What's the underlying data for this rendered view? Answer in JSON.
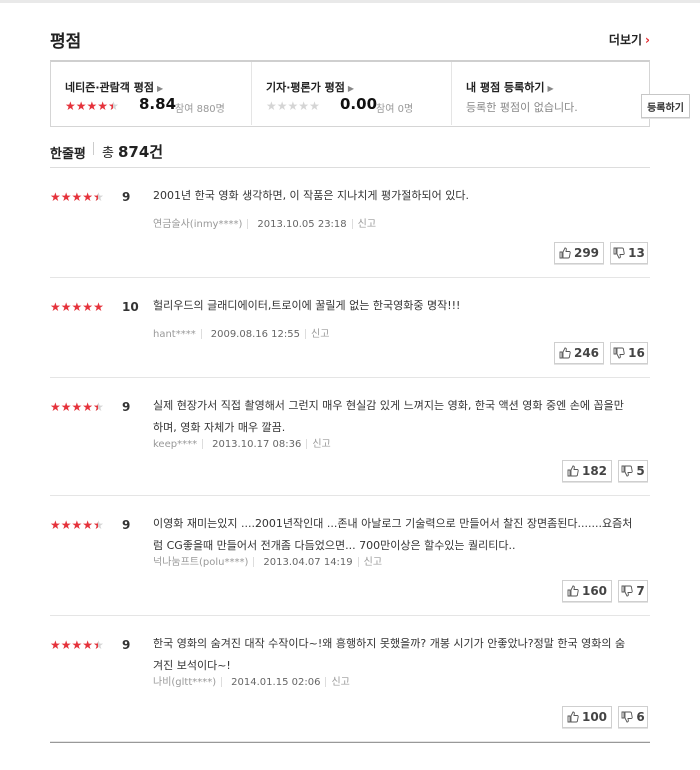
{
  "section": {
    "title": "평점",
    "more_label": "더보기"
  },
  "scores": {
    "netizen": {
      "label": "네티즌·관람객 평점",
      "stars": 4.5,
      "score": "8.84",
      "count": "참여 880명"
    },
    "critic": {
      "label": "기자·평론가 평점",
      "stars": 0,
      "score": "0.00",
      "count": "참여 0명"
    },
    "mine": {
      "label": "내 평점 등록하기",
      "note": "등록한 평점이 없습니다.",
      "button": "등록하기"
    }
  },
  "oneline": {
    "label": "한줄평",
    "total_prefix": "총",
    "total": "874",
    "total_suffix": "건"
  },
  "reviews": [
    {
      "stars": 4.5,
      "score": "9",
      "text": "2001년 한국 영화 생각하면, 이 작품은 지나치게 평가절하되어 있다.",
      "user": "연금술사(inmy****)",
      "date": "2013.10.05 23:18",
      "report": "신고",
      "up": "299",
      "down": "13"
    },
    {
      "stars": 5,
      "score": "10",
      "text": "헐리우드의 글래디에이터,트로이에 꿀릴게 없는 한국영화중 명작!!!",
      "user": "hant****",
      "date": "2009.08.16 12:55",
      "report": "신고",
      "up": "246",
      "down": "16"
    },
    {
      "stars": 4.5,
      "score": "9",
      "text": "실제 현장가서 직접 촬영해서 그런지 매우 현실감 있게 느껴지는 영화, 한국 액션 영화 중엔 손에 꼽을만 하며, 영화 자체가 매우 깔끔.",
      "user": "keep****",
      "date": "2013.10.17 08:36",
      "report": "신고",
      "up": "182",
      "down": "5"
    },
    {
      "stars": 4.5,
      "score": "9",
      "text": "이영화 재미는있지 ....2001년작인대 ...존내 아날로그 기술력으로 만들어서 찰진 장면좀된다.......요즘처럼 CG좋을때 만들어서 전개좀 다듬었으면... 700만이상은 할수있는 퀄리티다..",
      "user": "넉나눔프트(polu****)",
      "date": "2013.04.07 14:19",
      "report": "신고",
      "up": "160",
      "down": "7"
    },
    {
      "stars": 4.5,
      "score": "9",
      "text": "한국 영화의 숨겨진 대작 수작이다~!왜 흥행하지 못했을까? 개봉 시기가 안좋았나?정말 한국 영화의 숨겨진 보석이다~!",
      "user": "나비(gltt****)",
      "date": "2014.01.15 02:06",
      "report": "신고",
      "up": "100",
      "down": "6"
    }
  ]
}
